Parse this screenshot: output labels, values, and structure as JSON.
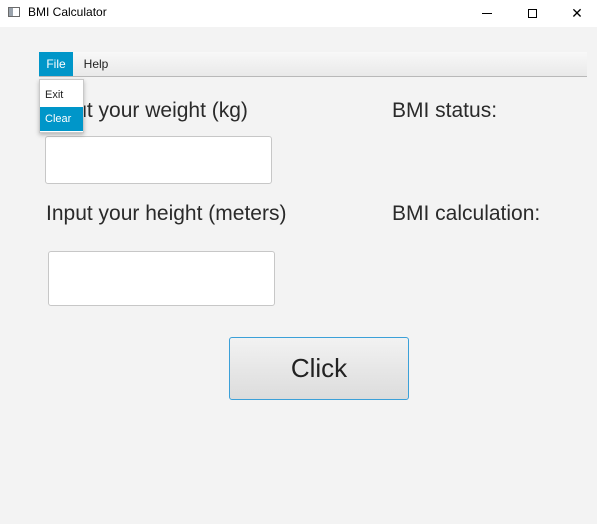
{
  "window": {
    "title": "BMI Calculator",
    "close_glyph": "✕"
  },
  "menubar": {
    "file_label": "File",
    "help_label": "Help"
  },
  "file_menu": {
    "items": [
      "Exit",
      "Clear"
    ],
    "highlighted": "Clear"
  },
  "form": {
    "weight_label": "Input your weight (kg)",
    "weight_visible_text": "ut your weight (kg)",
    "weight_value": "",
    "height_label": "Input your height (meters)",
    "height_value": "",
    "status_label": "BMI status:",
    "calc_label": "BMI calculation:",
    "button_label": "Click"
  },
  "colors": {
    "accent": "#0096c9",
    "background": "#f3f3f3",
    "button_border": "#3ba0d8"
  }
}
